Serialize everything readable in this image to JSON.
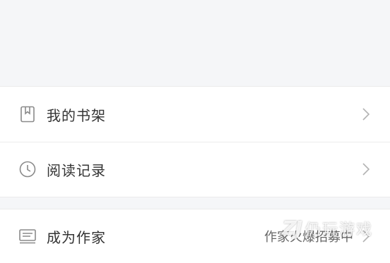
{
  "menu_group_1": [
    {
      "label": "我的书架",
      "icon": "bookmark-icon"
    },
    {
      "label": "阅读记录",
      "icon": "clock-icon"
    }
  ],
  "menu_group_2": [
    {
      "label": "成为作家",
      "icon": "document-lines-icon",
      "hint": "作家火爆招募中"
    }
  ],
  "watermark": {
    "logo": "ZJ",
    "text": "仍玩游戏"
  },
  "colors": {
    "background": "#f5f6f8",
    "card": "#ffffff",
    "text": "#333333",
    "divider": "#ebebeb",
    "icon": "#888888"
  }
}
